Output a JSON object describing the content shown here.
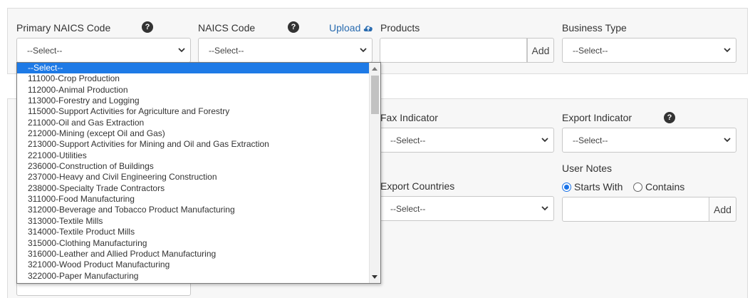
{
  "top": {
    "primary_naics_label": "Primary NAICS Code",
    "primary_naics_value": "--Select--",
    "naics_label": "NAICS Code",
    "naics_value": "--Select--",
    "upload_label": "Upload",
    "products_label": "Products",
    "products_value": "",
    "products_add": "Add",
    "business_type_label": "Business Type",
    "business_type_value": "--Select--",
    "help": "?"
  },
  "bottom": {
    "fax_label": "Fax Indicator",
    "fax_value": "--Select--",
    "export_ind_label": "Export Indicator",
    "export_ind_value": "--Select--",
    "export_countries_label": "Export Countries",
    "export_countries_value": "--Select--",
    "user_notes_label": "User Notes",
    "starts_with": "Starts With",
    "contains": "Contains",
    "notes_add": "Add"
  },
  "dropdown": {
    "selected_index": 0,
    "options": [
      "--Select--",
      "111000-Crop Production",
      "112000-Animal Production",
      "113000-Forestry and Logging",
      "115000-Support Activities for Agriculture and Forestry",
      "211000-Oil and Gas Extraction",
      "212000-Mining (except Oil and Gas)",
      "213000-Support Activities for Mining and Oil and Gas Extraction",
      "221000-Utilities",
      "236000-Construction of Buildings",
      "237000-Heavy and Civil Engineering Construction",
      "238000-Specialty Trade Contractors",
      "311000-Food Manufacturing",
      "312000-Beverage and Tobacco Product Manufacturing",
      "313000-Textile Mills",
      "314000-Textile Product Mills",
      "315000-Clothing Manufacturing",
      "316000-Leather and Allied Product Manufacturing",
      "321000-Wood Product Manufacturing",
      "322000-Paper Manufacturing"
    ]
  },
  "colors": {
    "accent": "#1e7ae6",
    "link": "#2a6cb0"
  }
}
